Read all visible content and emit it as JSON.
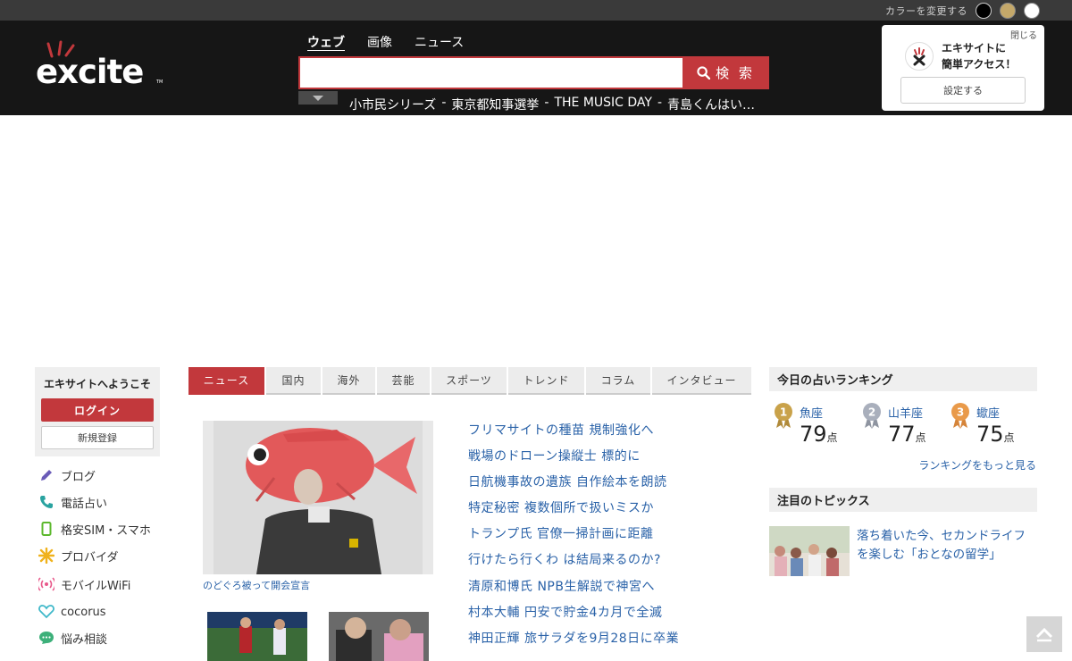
{
  "colorbar": {
    "label": "カラーを変更する"
  },
  "header": {
    "logo_text": "excite",
    "search_tabs": [
      "ウェブ",
      "画像",
      "ニュース"
    ],
    "search_button": "検 索",
    "search_value": "",
    "trends": [
      "小市民シリーズ",
      "東京都知事選挙",
      "THE MUSIC DAY",
      "青島くんはい…"
    ],
    "trend_sep": "-"
  },
  "quick_access": {
    "close": "閉じる",
    "line1": "エキサイトに",
    "line2": "簡単アクセス！",
    "button": "設定する"
  },
  "welcome": {
    "title": "エキサイトへようこそ",
    "login": "ログイン",
    "register": "新規登録"
  },
  "services": [
    {
      "label": "ブログ",
      "icon": "pencil-icon"
    },
    {
      "label": "電話占い",
      "icon": "phone-icon"
    },
    {
      "label": "格安SIM・スマホ",
      "icon": "smartphone-icon"
    },
    {
      "label": "プロバイダ",
      "icon": "sparkle-icon"
    },
    {
      "label": "モバイルWiFi",
      "icon": "wifi-icon"
    },
    {
      "label": "cocorus",
      "icon": "heart-icon"
    },
    {
      "label": "悩み相談",
      "icon": "chat-icon"
    }
  ],
  "news_tabs": [
    "ニュース",
    "国内",
    "海外",
    "芸能",
    "スポーツ",
    "トレンド",
    "コラム",
    "インタビュー"
  ],
  "main_caption": "のどぐろ被って開会宣言",
  "headlines": [
    "フリマサイトの種苗 規制強化へ",
    "戦場のドローン操縦士 標的に",
    "日航機事故の遺族 自作絵本を朗読",
    "特定秘密 複数個所で扱いミスか",
    "トランプ氏 官僚一掃計画に距離",
    "行けたら行くわ は結局来るのか?",
    "清原和博氏 NPB生解説で神宮へ",
    "村本大輔 円安で貯金4カ月で全滅",
    "神田正輝 旅サラダを9月28日に卒業"
  ],
  "fortune": {
    "title": "今日の占いランキング",
    "ranks": [
      {
        "rank": "1",
        "sign": "魚座",
        "score": "79",
        "color": "#c9a24a"
      },
      {
        "rank": "2",
        "sign": "山羊座",
        "score": "77",
        "color": "#a9afbc"
      },
      {
        "rank": "3",
        "sign": "蠍座",
        "score": "75",
        "color": "#e99a4a"
      }
    ],
    "unit": "点",
    "more": "ランキングをもっと見る"
  },
  "topics": {
    "title": "注目のトピックス",
    "item": "落ち着いた今、セカンドライフを楽しむ「おとなの留学」"
  },
  "colors": {
    "accent": "#c2383c",
    "link": "#2a62a8",
    "header_bg": "#161616"
  }
}
